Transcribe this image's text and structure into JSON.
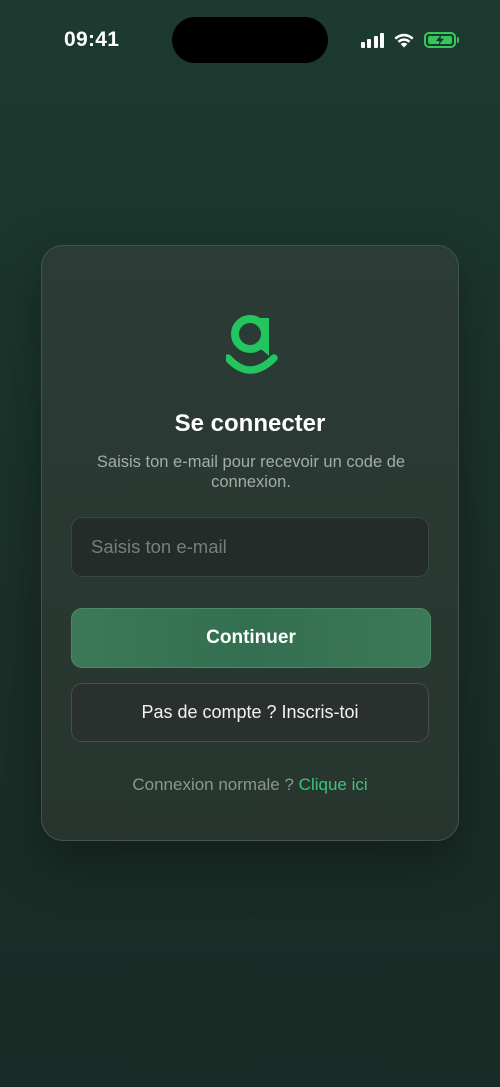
{
  "status_bar": {
    "time": "09:41",
    "icons": [
      "cellular-signal-icon",
      "wifi-icon",
      "battery-charging-icon"
    ]
  },
  "login_card": {
    "logo_icon": "g-chat-logo-icon",
    "title": "Se connecter",
    "subtitle": "Saisis ton e-mail pour recevoir un code de connexion.",
    "email_placeholder": "Saisis ton e-mail",
    "email_value": "",
    "continue_label": "Continuer",
    "signup_label": "Pas de compte ? Inscris-toi",
    "footer_text": "Connexion normale ? ",
    "footer_link": "Clique ici"
  },
  "colors": {
    "accent": "#22c55e",
    "primary_button": "#3a7556",
    "link": "#3dc576",
    "background": "#1b3229",
    "battery": "#34c759"
  }
}
